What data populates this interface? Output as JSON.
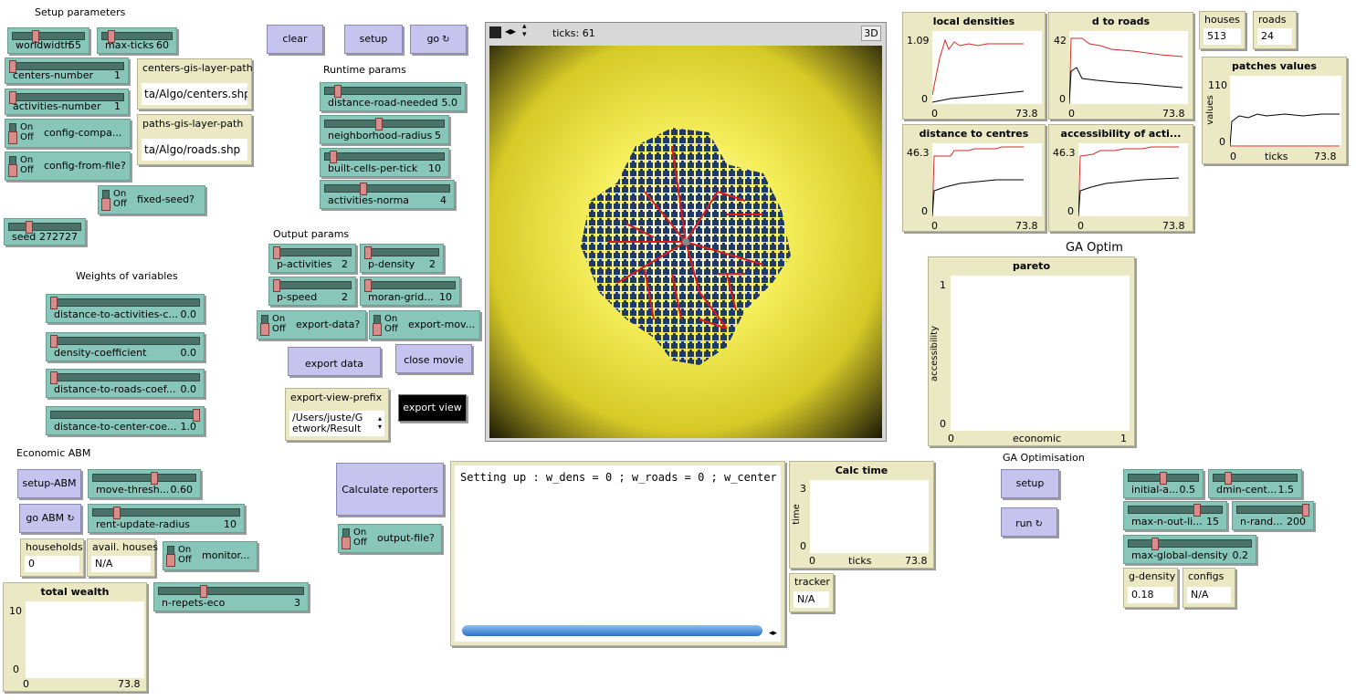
{
  "labels": {
    "setup_parameters": "Setup parameters",
    "weights_of_variables": "Weights of variables",
    "economic_abm": "Economic ABM",
    "runtime_params": "Runtime params",
    "output_params": "Output params",
    "ga_optim": "GA Optim",
    "ga_optimisation": "GA Optimisation"
  },
  "buttons": {
    "clear": "clear",
    "setup": "setup",
    "go": "go",
    "export_data": "export data",
    "close_movie": "close movie",
    "export_view": "export view",
    "setup_abm": "setup-ABM",
    "go_abm": "go ABM",
    "calculate_reporters": "Calculate reporters",
    "ga_setup": "setup",
    "ga_run": "run"
  },
  "sliders": {
    "worldwidth": {
      "name": "worldwidth",
      "value": "55",
      "level": 0.3
    },
    "max_ticks": {
      "name": "max-ticks",
      "value": "60",
      "level": 0.1
    },
    "centers_number": {
      "name": "centers-number",
      "value": "1",
      "level": 0.0
    },
    "activities_number": {
      "name": "activities-number",
      "value": "1",
      "level": 0.0
    },
    "seed": {
      "name": "seed",
      "value": "272727",
      "level": 0.27
    },
    "distance_to_activities": {
      "name": "distance-to-activities-c...",
      "value": "0.0",
      "level": 0.0
    },
    "density_coefficient": {
      "name": "density-coefficient",
      "value": "0.0",
      "level": 0.0
    },
    "distance_to_roads": {
      "name": "distance-to-roads-coef...",
      "value": "0.0",
      "level": 0.0
    },
    "distance_to_center": {
      "name": "distance-to-center-coe...",
      "value": "1.0",
      "level": 1.0
    },
    "distance_road_needed": {
      "name": "distance-road-needed",
      "value": "5.0",
      "level": 0.08
    },
    "neighborhood_radius": {
      "name": "neighborhood-radius",
      "value": "5",
      "level": 0.45
    },
    "built_cells_per_tick": {
      "name": "built-cells-per-tick",
      "value": "10",
      "level": 0.05
    },
    "activities_norma": {
      "name": "activities-norma",
      "value": "4",
      "level": 0.3
    },
    "p_activities": {
      "name": "p-activities",
      "value": "2",
      "level": 0.0
    },
    "p_density": {
      "name": "p-density",
      "value": "2",
      "level": 0.0
    },
    "p_speed": {
      "name": "p-speed",
      "value": "2",
      "level": 0.0
    },
    "moran_grid": {
      "name": "moran-grid...",
      "value": "10",
      "level": 0.0
    },
    "move_thresh": {
      "name": "move-thresh...",
      "value": "0.60",
      "level": 0.6
    },
    "rent_update_radius": {
      "name": "rent-update-radius",
      "value": "10",
      "level": 0.15
    },
    "n_repets_eco": {
      "name": "n-repets-eco",
      "value": "3",
      "level": 0.3
    },
    "initial_a": {
      "name": "initial-a...",
      "value": "0.5",
      "level": 0.5
    },
    "dmin_cent": {
      "name": "dmin-cent...",
      "value": "1.5",
      "level": 0.15
    },
    "max_n_out_li": {
      "name": "max-n-out-li...",
      "value": "15",
      "level": 0.75
    },
    "n_rand": {
      "name": "n-rand...",
      "value": "200",
      "level": 1.0
    },
    "max_global_density": {
      "name": "max-global-density",
      "value": "0.2",
      "level": 0.2
    }
  },
  "switches": {
    "on": "On",
    "off": "Off",
    "config_compa": "config-compa...",
    "config_from_file": "config-from-file?",
    "fixed_seed": "fixed-seed?",
    "export_data_q": "export-data?",
    "export_mov": "export-mov...",
    "monitor": "monitor...",
    "output_file": "output-file?"
  },
  "inputs": {
    "centers_path": {
      "name": "centers-gis-layer-path",
      "value": "ta/Algo/centers.shp"
    },
    "paths_path": {
      "name": "paths-gis-layer-path",
      "value": "ta/Algo/roads.shp"
    },
    "export_prefix": {
      "name": "export-view-prefix",
      "value": "/Users/juste/G",
      "value2": "etwork/Result"
    }
  },
  "monitors": {
    "houses": {
      "name": "houses",
      "value": "513"
    },
    "roads": {
      "name": "roads",
      "value": "24"
    },
    "households": {
      "name": "households",
      "value": "0"
    },
    "avail_houses": {
      "name": "avail. houses",
      "value": "N/A"
    },
    "tracker": {
      "name": "tracker",
      "value": "N/A"
    },
    "g_density": {
      "name": "g-density",
      "value": "0.18"
    },
    "configs": {
      "name": "configs",
      "value": "N/A"
    }
  },
  "view": {
    "ticks": "ticks: 61",
    "btn3d": "3D"
  },
  "output_text": "Setting up : w_dens = 0 ; w_roads = 0 ; w_center",
  "plots": {
    "local_densities": {
      "title": "local densities",
      "ymax": "1.09",
      "ymin": "0",
      "xmin": "0",
      "xmax": "73.8"
    },
    "d_to_roads": {
      "title": "d to roads",
      "ymax": "42",
      "ymin": "0",
      "xmin": "0",
      "xmax": "73.8"
    },
    "patches_values": {
      "title": "patches values",
      "ymax": "110",
      "ymin": "0",
      "xmin": "0",
      "xmax": "73.8",
      "ylabel": "values",
      "xlabel": "ticks"
    },
    "distance_to_centres": {
      "title": "distance to centres",
      "ymax": "46.3",
      "ymin": "0",
      "xmin": "0",
      "xmax": "73.8"
    },
    "accessibility": {
      "title": "accessibility of acti...",
      "ymax": "46.3",
      "ymin": "0",
      "xmin": "0",
      "xmax": "73.8"
    },
    "pareto": {
      "title": "pareto",
      "ymax": "1",
      "ymin": "0",
      "xmin": "0",
      "xmax": "1",
      "ylabel": "accessibility",
      "xlabel": "economic"
    },
    "calc_time": {
      "title": "Calc time",
      "ymax": "3",
      "ymin": "0",
      "xmin": "0",
      "xmax": "73.8",
      "ylabel": "time",
      "xlabel": "ticks"
    },
    "total_wealth": {
      "title": "total wealth",
      "ymax": "10",
      "ymin": "0",
      "xmin": "0",
      "xmax": "73.8"
    }
  },
  "colors": {
    "button": "#c6c4ee",
    "slider": "#87c6b9",
    "monitor": "#ebe9c4",
    "series_red": "#d42a2a",
    "series_black": "#000000"
  }
}
